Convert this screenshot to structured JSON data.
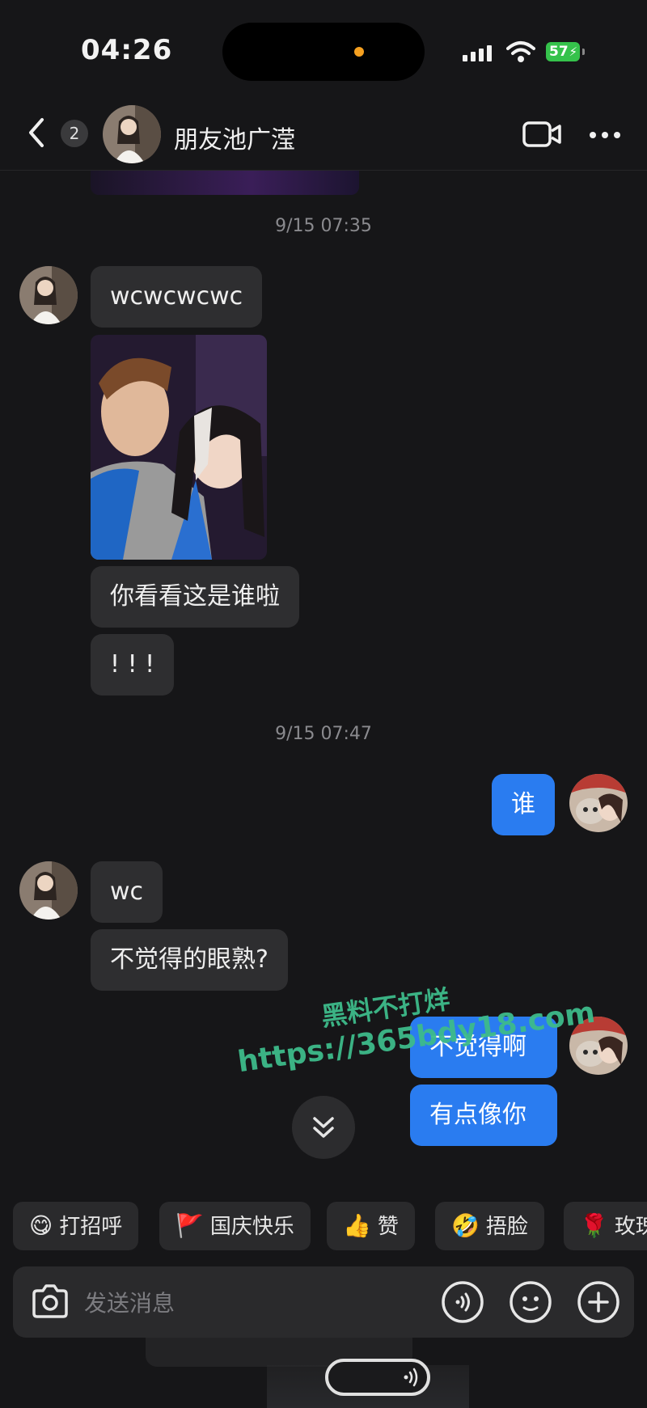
{
  "status_bar": {
    "time": "04:26",
    "battery": "57"
  },
  "header": {
    "unread_count": "2",
    "contact_name": "朋友池广滢"
  },
  "chat": {
    "timestamp_1": "9/15 07:35",
    "timestamp_2": "9/15 07:47",
    "messages": [
      {
        "side": "in",
        "text": "wcwcwcwc"
      },
      {
        "side": "in",
        "type": "image"
      },
      {
        "side": "in",
        "text": "你看看这是谁啦"
      },
      {
        "side": "in",
        "text": "! ! !"
      },
      {
        "side": "out",
        "text": "谁"
      },
      {
        "side": "in",
        "text": "wc"
      },
      {
        "side": "in",
        "text": "不觉得的眼熟?"
      },
      {
        "side": "out",
        "text": "不觉得啊"
      },
      {
        "side": "out",
        "text": "有点像你"
      }
    ]
  },
  "watermark": {
    "line1": "黑料不打烊",
    "line2": "https://365bdy18.com"
  },
  "quick_replies": [
    {
      "emoji": "😋",
      "label": "打招呼"
    },
    {
      "emoji": "🚩",
      "label": "国庆快乐"
    },
    {
      "emoji": "👍",
      "label": "赞"
    },
    {
      "emoji": "🤣",
      "label": "捂脸"
    },
    {
      "emoji": "🌹",
      "label": "玫瑰"
    }
  ],
  "input": {
    "placeholder": "发送消息"
  }
}
